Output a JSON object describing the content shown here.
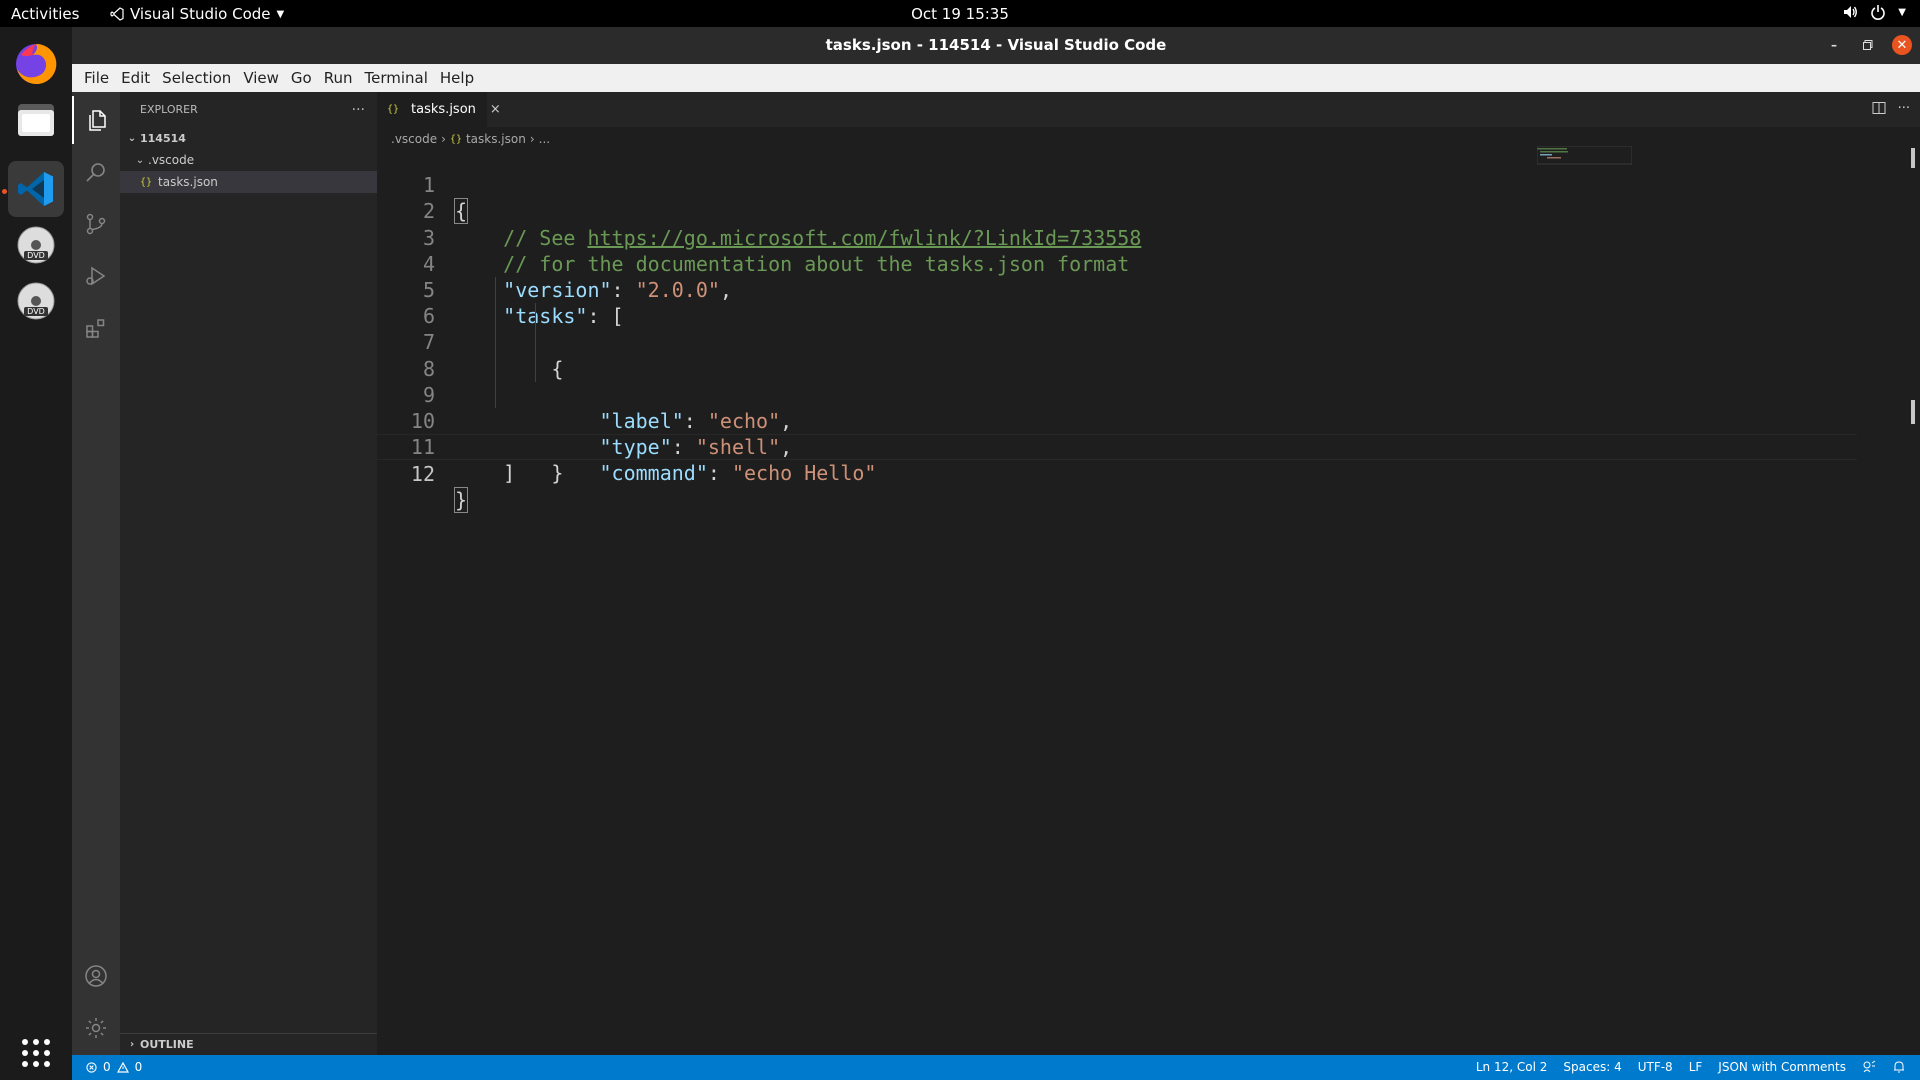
{
  "topbar": {
    "activities": "Activities",
    "app_name": "Visual Studio Code",
    "clock": "Oct 19  15:35"
  },
  "dock": {
    "items": [
      "firefox-icon",
      "files-icon",
      "vscode-icon",
      "dvd-icon",
      "dvd-icon",
      "app-grid-icon"
    ]
  },
  "window": {
    "title": "tasks.json - 114514 - Visual Studio Code"
  },
  "menubar": {
    "items": [
      "File",
      "Edit",
      "Selection",
      "View",
      "Go",
      "Run",
      "Terminal",
      "Help"
    ]
  },
  "sidebar": {
    "title": "EXPLORER",
    "more": "···",
    "root_folder": "114514",
    "subfolder": ".vscode",
    "file": "tasks.json",
    "outline": "OUTLINE",
    "file_icon": "{}"
  },
  "editor": {
    "tab_label": "tasks.json",
    "tab_close": "×",
    "breadcrumb": [
      ".vscode",
      "tasks.json",
      "..."
    ],
    "lines": [
      {
        "n": "1"
      },
      {
        "n": "2"
      },
      {
        "n": "3"
      },
      {
        "n": "4"
      },
      {
        "n": "5"
      },
      {
        "n": "6"
      },
      {
        "n": "7"
      },
      {
        "n": "8"
      },
      {
        "n": "9"
      },
      {
        "n": "10"
      },
      {
        "n": "11"
      },
      {
        "n": "12"
      }
    ],
    "code": {
      "l1_open": "{",
      "l2_comment": "// See ",
      "l2_link": "https://go.microsoft.com/fwlink/?LinkId=733558",
      "l3_comment": "// for the documentation about the tasks.json format",
      "l4_key": "\"version\"",
      "l4_sep": ": ",
      "l4_val": "\"2.0.0\"",
      "l4_end": ",",
      "l5_key": "\"tasks\"",
      "l5_sep": ": [",
      "l6_open": "{",
      "l7_key": "\"label\"",
      "l7_val": "\"echo\"",
      "l8_key": "\"type\"",
      "l8_val": "\"shell\"",
      "l9_key": "\"command\"",
      "l9_val": "\"echo Hello\"",
      "l10_close": "}",
      "l11_close": "]",
      "l12_close": "}",
      "sep": ": ",
      "comma": ","
    }
  },
  "statusbar": {
    "errors": "0",
    "warnings": "0",
    "position": "Ln 12, Col 2",
    "spaces": "Spaces: 4",
    "encoding": "UTF-8",
    "eol": "LF",
    "language": "JSON with Comments"
  },
  "colors": {
    "accent": "#007acc",
    "ubuntu_orange": "#e95420",
    "editor_bg": "#1e1e1e",
    "sidebar_bg": "#252526",
    "activitybar_bg": "#333333"
  }
}
